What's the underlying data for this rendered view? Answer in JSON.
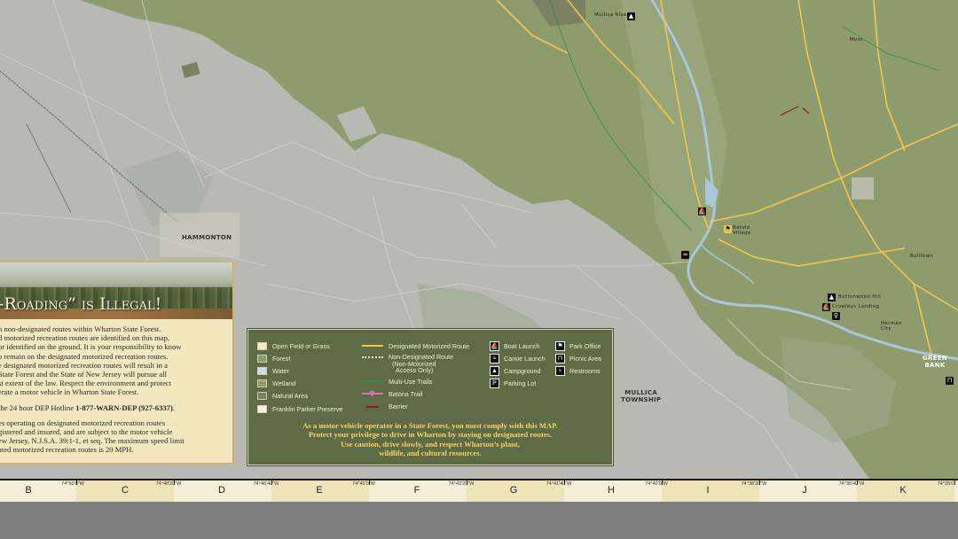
{
  "places": {
    "hammonton": "HAMMONTON",
    "mullica_township": "MULLICA\nTOWNSHIP",
    "green_bank": "GREEN\nBANK",
    "mullica_river": "Mullica River",
    "batsto": "Batsto\nVillage",
    "buttonwood_hill": "Buttonwood Hill",
    "crowleys_landing": "Crowleys Landing",
    "herman": "Herman\nCity",
    "bulltown": "Bulltown",
    "moorsh": "Moor"
  },
  "warning": {
    "title": "-Roading” is Illegal!",
    "p1": [
      "n non-designated routes within Wharton State Forest.",
      "d motorized recreation routes are identified on this map,",
      "or identified on the ground. It is your responsibility to know",
      "o remain on the designated motorized recreation routes.",
      "e designated motorized recreation routes will result in a",
      "State Forest and the State of New Jersey will pursue all",
      "st extent of the law. Respect the environment and protect",
      "erate a motor vehicle in Wharton State Forest."
    ],
    "p2_prefix": "the 24 hour DEP Hotline ",
    "p2_hotline": "1-877-WARN-DEP (927-6337)",
    "p2_suffix": ".",
    "p3": [
      "es operating on designated motorized recreation routes",
      "gistered and insured, and are subject to the motor vehicle",
      "ew Jersey, N.J.S.A. 39:1-1, et seq. The maximum speed limit",
      "ated motorized recreation routes is 20 MPH."
    ]
  },
  "legend": {
    "land": [
      {
        "label": "Open Field or Grass",
        "color": "#f3eacc"
      },
      {
        "label": "Forest",
        "color": "#8c9a6c"
      },
      {
        "label": "Water",
        "color": "#c9dceb"
      },
      {
        "label": "Wetland",
        "color": "#8a9468"
      },
      {
        "label": "Natural Area",
        "color": "#7b8161"
      },
      {
        "label": "Franklin Parker Preserve",
        "color": "#f4f1e0"
      }
    ],
    "routes": [
      {
        "label": "Designated Motorized Route",
        "color": "#f2c64a",
        "style": "solid"
      },
      {
        "label": "Non-Designated Route",
        "sub1": "(Non-Motorized",
        "sub2": "Access Only)",
        "color": "#e8e2c2",
        "style": "dotted"
      },
      {
        "label": "Multi-Use Trails",
        "color": "#3c8a4a",
        "style": "solid"
      },
      {
        "label": "Batona Trail",
        "color": "#d377b4",
        "style": "pink"
      },
      {
        "label": "Barrier",
        "color": "#8a1d1d",
        "style": "barrier"
      }
    ],
    "facilities_a": [
      {
        "label": "Boat Launch",
        "icon": "boat-launch-icon",
        "glyph": "⛵"
      },
      {
        "label": "Canoe Launch",
        "icon": "canoe-launch-icon",
        "glyph": "≈"
      },
      {
        "label": "Campground",
        "icon": "campground-icon",
        "glyph": "▲"
      },
      {
        "label": "Parking Lot",
        "icon": "parking-lot-icon",
        "glyph": "P"
      }
    ],
    "facilities_b": [
      {
        "label": "Park Office",
        "icon": "park-office-icon",
        "glyph": "⚑"
      },
      {
        "label": "Picnic Area",
        "icon": "picnic-area-icon",
        "glyph": "⊓"
      },
      {
        "label": "Restrooms",
        "icon": "restrooms-icon",
        "glyph": "♀"
      }
    ],
    "note": [
      "As a motor vehicle operator in a State Forest, you must comply with this MAP.",
      "Protect your privilege to drive in Wharton by staying on designated routes.",
      "Use caution, drive slowly, and respect Wharton’s plant,",
      "wildlife, and cultural resources."
    ]
  },
  "grid": {
    "letters": [
      "B",
      "C",
      "D",
      "E",
      "F",
      "G",
      "H",
      "I",
      "J",
      "K"
    ],
    "coords": [
      "74°50'0\"W",
      "74°48'20\"W",
      "74°46'40\"W",
      "74°45'0\"W",
      "74°43'20\"W",
      "74°41'40\"W",
      "74°40'0\"W",
      "74°38'20\"W",
      "74°36'40\"W",
      "74°35'0"
    ]
  }
}
